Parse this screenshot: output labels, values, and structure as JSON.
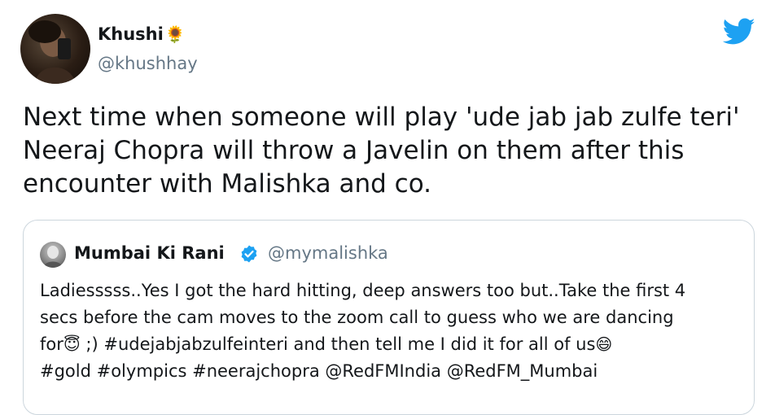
{
  "tweet": {
    "author_name": "Khushi",
    "author_emoji": "🌻",
    "author_handle": "@khushhay",
    "text_lines": [
      "Next time when someone will play 'ude jab jab zulfe teri'",
      "Neeraj Chopra will throw a Javelin on them after this",
      "encounter with Malishka and co."
    ]
  },
  "icons": {
    "brand": "twitter-bird-icon",
    "verified": "verified-badge-icon"
  },
  "quote": {
    "author_name": "Mumbai Ki Rani",
    "author_handle": "@mymalishka",
    "line1": "Ladiesssss..Yes I got the hard hitting, deep answers too but..Take the first 4",
    "line2": "secs before the cam moves to the zoom call to guess who we are dancing",
    "line3_a": "for",
    "line3_emoji1": "😇",
    "line3_b": " ;) #udejabjabzulfeinteri and then tell me I did it for all of us",
    "line3_emoji2": "😄",
    "line4": "#gold #olympics #neerajchopra @RedFMIndia @RedFM_Mumbai"
  },
  "colors": {
    "twitter_blue": "#1da1f2",
    "text": "#14171a",
    "secondary": "#657786",
    "border": "#ccd6dd"
  }
}
